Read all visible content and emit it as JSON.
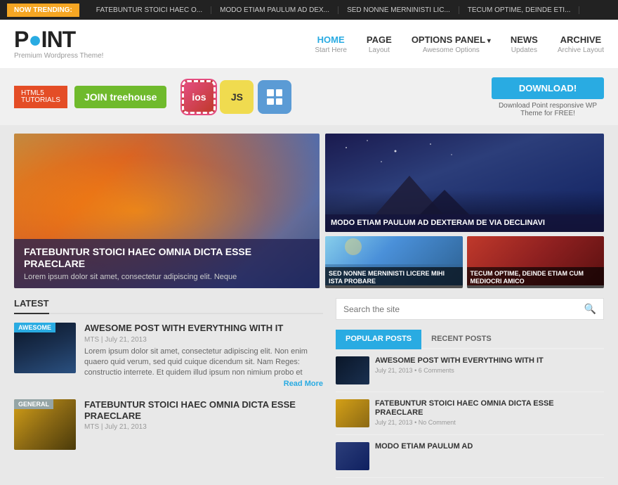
{
  "trending": {
    "label": "NOW TRENDING:",
    "items": [
      "FATEBUNTUR STOICI HAEC O...",
      "MODO ETIAM PAULUM AD DEX...",
      "SED NONNE MERNINISTI LIC...",
      "TECUM OPTIME, DEINDE ETI..."
    ]
  },
  "header": {
    "logo": "P INT",
    "logo_dot": "O",
    "tagline": "Premium Wordpress Theme!",
    "nav": [
      {
        "label": "HOME",
        "sub": "Start Here",
        "active": true,
        "dropdown": false
      },
      {
        "label": "PAGE",
        "sub": "Layout",
        "active": false,
        "dropdown": false
      },
      {
        "label": "OPTIONS PANEL",
        "sub": "Awesome Options",
        "active": false,
        "dropdown": true
      },
      {
        "label": "NEWS",
        "sub": "Updates",
        "active": false,
        "dropdown": false
      },
      {
        "label": "ARCHIVE",
        "sub": "Archive Layout",
        "active": false,
        "dropdown": false
      }
    ]
  },
  "banner": {
    "html5_label": "HTML5",
    "html5_sub": "TUTORIALS",
    "treehouse_label": "JOIN treehouse",
    "ios_label": "ios",
    "js_label": "JS",
    "download_btn": "DOWNLOAD!",
    "download_text": "Download Point responsive WP Theme for FREE!"
  },
  "featured": {
    "title": "FATEBUNTUR STOICI HAEC OMNIA DICTA ESSE PRAECLARE",
    "excerpt": "Lorem ipsum dolor sit amet, consectetur adipiscing elit. Neque"
  },
  "side_posts": {
    "main": {
      "title": "MODO ETIAM PAULUM AD DEXTERAM DE VIA DECLINAVI"
    },
    "thumb1": {
      "title": "SED NONNE MERNINISTI LICERE MIHI ISTA PROBARE"
    },
    "thumb2": {
      "title": "TECUM OPTIME, DEINDE ETIAM CUM MEDIOCRI AMICO"
    }
  },
  "latest": {
    "section_title": "LATEST",
    "posts": [
      {
        "tag": "AWESOME",
        "tag_class": "tag-awesome",
        "thumb_class": "park",
        "title": "AWESOME POST WITH EVERYTHING WITH IT",
        "author": "MTS",
        "date": "July 21, 2013",
        "excerpt": "Lorem ipsum dolor sit amet, consectetur adipiscing elit. Non enim quaero quid verum, sed quid cuique dicendum sit. Nam Reges: constructio interrete. Et quidem illud ipsum non nimium probo et",
        "read_more": "Read More"
      },
      {
        "tag": "GENERAL",
        "tag_class": "tag-general",
        "thumb_class": "leaves",
        "title": "FATEBUNTUR STOICI HAEC OMNIA DICTA ESSE PRAECLARE",
        "author": "MTS",
        "date": "July 21, 2013",
        "excerpt": "",
        "read_more": ""
      }
    ]
  },
  "sidebar": {
    "search_placeholder": "Search the site",
    "tabs": [
      {
        "label": "POPULAR POSTS",
        "active": true
      },
      {
        "label": "RECENT POSTS",
        "active": false
      }
    ],
    "popular_posts": [
      {
        "thumb_class": "p1",
        "title": "AWESOME POST WITH EVERYTHING WITH IT",
        "date": "July 21, 2013",
        "comments": "6 Comments"
      },
      {
        "thumb_class": "p2",
        "title": "FATEBUNTUR STOICI HAEC OMNIA DICTA ESSE PRAECLARE",
        "date": "July 21, 2013",
        "comments": "No Comment"
      },
      {
        "thumb_class": "p3",
        "title": "MODO ETIAM PAULUM AD",
        "date": "",
        "comments": ""
      }
    ]
  }
}
